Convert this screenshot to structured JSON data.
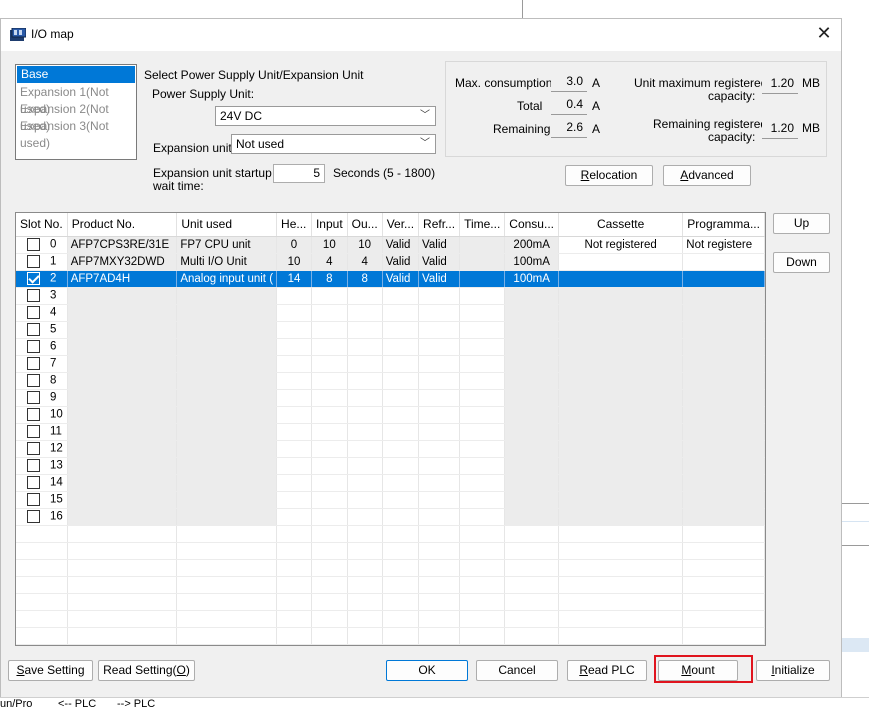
{
  "dialog": {
    "title": "I/O map",
    "close_label": "✕"
  },
  "unit_list": [
    "Base",
    "Expansion 1(Not used)",
    "Expansion 2(Not used)",
    "Expansion 3(Not used)"
  ],
  "settings": {
    "section_label": "Select Power Supply Unit/Expansion Unit",
    "power_supply_label": "Power Supply Unit:",
    "power_supply_value": "24V DC",
    "expansion_label": "Expansion unit:",
    "expansion_value": "Not used",
    "startup_label_1": "Expansion unit startup",
    "startup_label_2": "wait time:",
    "startup_value": "5",
    "startup_range": "Seconds (5 - 1800)"
  },
  "consumption": {
    "max_label": "Max. consumption",
    "max_value": "3.0",
    "max_unit": "A",
    "total_label": "Total",
    "total_value": "0.4",
    "total_unit": "A",
    "remaining_label": "Remaining",
    "remaining_value": "2.6",
    "remaining_unit": "A",
    "unit_max_label_1": "Unit maximum registered",
    "unit_max_label_2": "capacity:",
    "unit_max_value": "1.20",
    "unit_max_unit": "MB",
    "rem_cap_label_1": "Remaining registered",
    "rem_cap_label_2": "capacity:",
    "rem_cap_value": "1.20",
    "rem_cap_unit": "MB"
  },
  "buttons": {
    "relocation_u": "R",
    "relocation_rest": "elocation",
    "advanced_u": "A",
    "advanced_rest": "dvanced",
    "up": "Up",
    "down": "Down",
    "save_u": "S",
    "save_rest": "ave Setting",
    "read_setting": "Read Setting(",
    "read_setting_u": "O",
    "read_setting_end": ")",
    "ok": "OK",
    "cancel": "Cancel",
    "read_plc_u": "R",
    "read_plc_rest": "ead PLC",
    "mount_u": "M",
    "mount_rest": "ount",
    "initialize_u": "I",
    "initialize_rest": "nitialize"
  },
  "table": {
    "headers": [
      "Slot No.",
      "Product No.",
      "Unit used",
      "He...",
      "Input",
      "Ou...",
      "Ver...",
      "Refr...",
      "Time...",
      "Consu...",
      "Cassette",
      "Programma..."
    ],
    "rows": [
      {
        "slot": "0",
        "product": "AFP7CPS3RE/31E",
        "unit": "FP7 CPU unit",
        "head": "0",
        "input": "10",
        "output": "10",
        "verify": "Valid",
        "refresh": "Valid",
        "time": "",
        "consumption": "200mA",
        "cassette": "Not registered",
        "program": "Not registere",
        "checked": false,
        "selected": false
      },
      {
        "slot": "1",
        "product": "AFP7MXY32DWD",
        "unit": "Multi I/O Unit",
        "head": "10",
        "input": "4",
        "output": "4",
        "verify": "Valid",
        "refresh": "Valid",
        "time": "",
        "consumption": "100mA",
        "cassette": "",
        "program": "",
        "checked": false,
        "selected": false
      },
      {
        "slot": "2",
        "product": "AFP7AD4H",
        "unit": "Analog input unit (",
        "head": "14",
        "input": "8",
        "output": "8",
        "verify": "Valid",
        "refresh": "Valid",
        "time": "",
        "consumption": "100mA",
        "cassette": "",
        "program": "",
        "checked": true,
        "selected": true
      },
      {
        "slot": "3"
      },
      {
        "slot": "4"
      },
      {
        "slot": "5"
      },
      {
        "slot": "6"
      },
      {
        "slot": "7"
      },
      {
        "slot": "8"
      },
      {
        "slot": "9"
      },
      {
        "slot": "10"
      },
      {
        "slot": "11"
      },
      {
        "slot": "12"
      },
      {
        "slot": "13"
      },
      {
        "slot": "14"
      },
      {
        "slot": "15"
      },
      {
        "slot": "16"
      }
    ]
  },
  "taskbar": {
    "item1": "un/Pro",
    "item2": "<-- PLC",
    "item3": "--> PLC"
  },
  "colors": {
    "selection": "#0078d7",
    "highlight_border": "#e0141e"
  }
}
